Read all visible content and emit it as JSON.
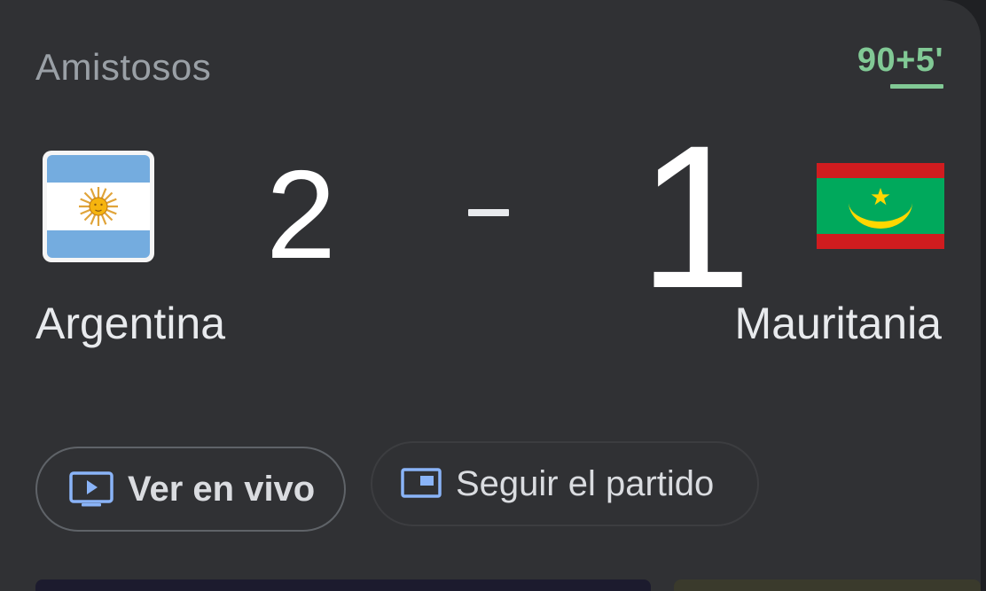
{
  "match": {
    "competition": "Amistosos",
    "clock": "90+5'",
    "home": {
      "name": "Argentina",
      "score": "2",
      "flag_icon": "argentina-flag-icon"
    },
    "away": {
      "name": "Mauritania",
      "score": "1",
      "flag_icon": "mauritania-flag-icon"
    }
  },
  "actions": {
    "watch_live_label": "Ver en vivo",
    "follow_label": "Seguir el partido"
  },
  "colors": {
    "card_bg": "#303134",
    "live_accent": "#81c995",
    "icon_blue": "#8ab4f8",
    "text_primary": "#ffffff",
    "text_secondary": "#9aa0a6"
  }
}
